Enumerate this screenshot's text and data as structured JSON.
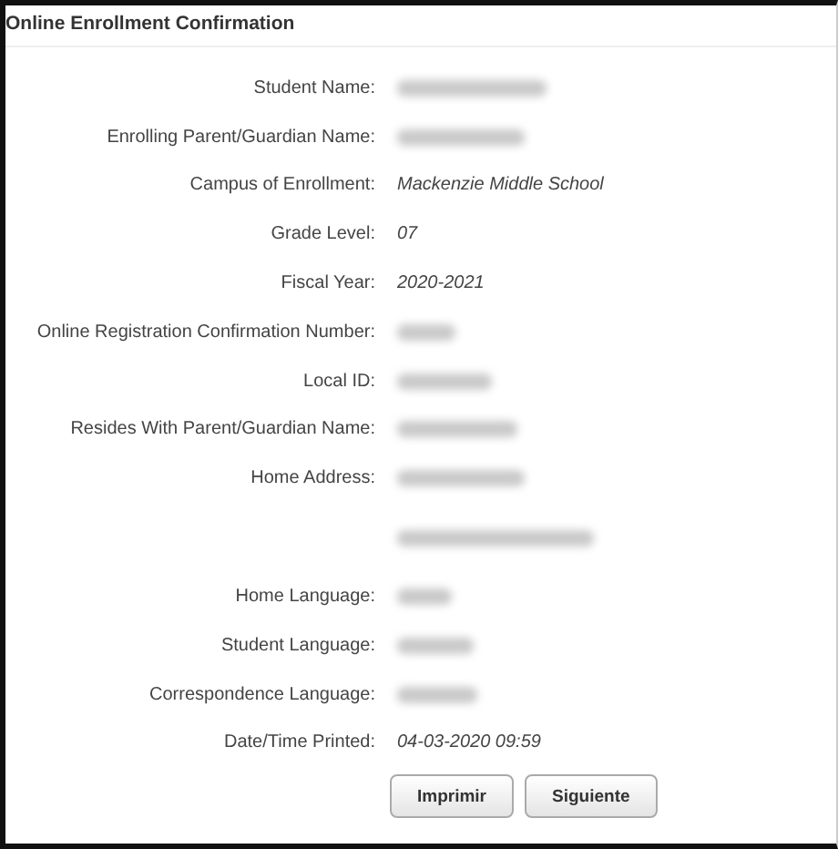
{
  "panel": {
    "title": "Online Enrollment Confirmation"
  },
  "fields": [
    {
      "label": "Student Name:",
      "kind": "redacted"
    },
    {
      "label": "Enrolling Parent/Guardian Name:",
      "kind": "redacted"
    },
    {
      "label": "Campus of Enrollment:",
      "kind": "text",
      "value": "Mackenzie Middle School"
    },
    {
      "label": "Grade Level:",
      "kind": "text",
      "value": "07"
    },
    {
      "label": "Fiscal Year:",
      "kind": "text",
      "value": "2020-2021"
    },
    {
      "label": "Online Registration Confirmation Number:",
      "kind": "redacted"
    },
    {
      "label": "Local ID:",
      "kind": "redacted"
    },
    {
      "label": "Resides With Parent/Guardian Name:",
      "kind": "redacted"
    },
    {
      "label": "Home Address:",
      "kind": "redacted"
    },
    {
      "kind": "redacted"
    },
    {
      "label": "Home Language:",
      "kind": "redacted"
    },
    {
      "label": "Student Language:",
      "kind": "redacted"
    },
    {
      "label": "Correspondence Language:",
      "kind": "redacted"
    },
    {
      "label": "Date/Time Printed:",
      "kind": "text",
      "value": "04-03-2020 09:59"
    }
  ],
  "buttons": [
    "Imprimir",
    "Siguiente"
  ]
}
